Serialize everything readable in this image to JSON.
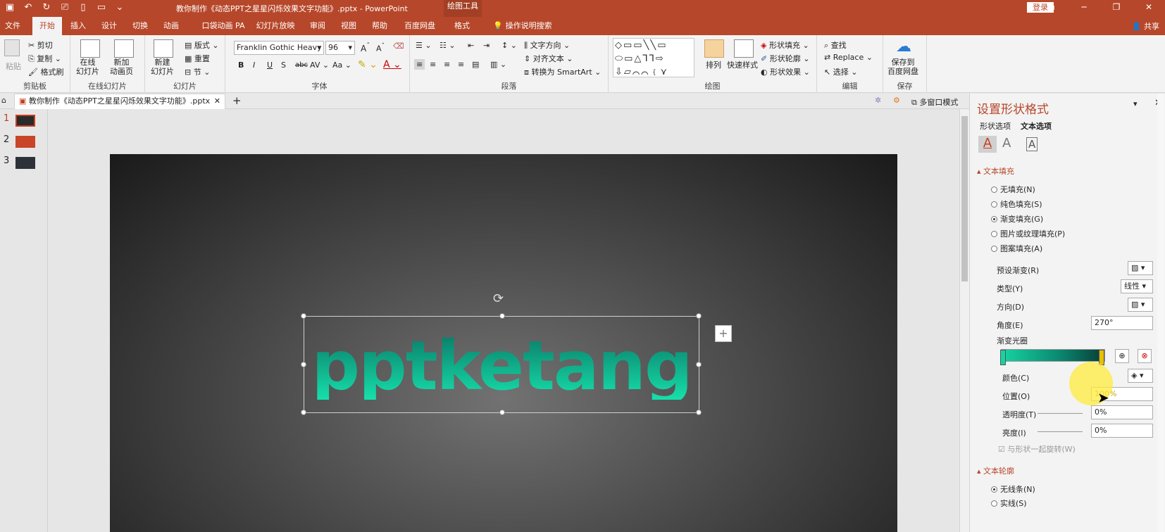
{
  "window": {
    "title": "教你制作《动态PPT之星星闪烁效果文字功能》.pptx  -  PowerPoint",
    "context_title": "绘图工具",
    "login": "登录"
  },
  "tabs": [
    "文件",
    "开始",
    "插入",
    "设计",
    "切换",
    "动画",
    "口袋动画 PA",
    "幻灯片放映",
    "审阅",
    "视图",
    "帮助",
    "百度网盘",
    "格式",
    "操作说明搜索"
  ],
  "active_tab": "开始",
  "share": "共享",
  "ribbon": {
    "clipboard": {
      "label": "剪贴板",
      "paste": "粘贴",
      "cut": "剪切",
      "copy": "复制",
      "format_painter": "格式刷"
    },
    "online": {
      "label": "在线幻灯片",
      "btn1": "在线\n幻灯片",
      "btn2": "新加\n动画页"
    },
    "slides": {
      "label": "幻灯片",
      "new": "新建\n幻灯片",
      "layout": "版式",
      "reset": "重置",
      "section": "节"
    },
    "font": {
      "label": "字体",
      "name": "Franklin Gothic Heavy",
      "size": "96"
    },
    "paragraph": {
      "label": "段落",
      "text_direction": "文字方向",
      "align_text": "对齐文本",
      "smartart": "转换为 SmartArt"
    },
    "drawing": {
      "label": "绘图",
      "arrange": "排列",
      "quick_styles": "快速样式",
      "fill": "形状填充",
      "outline": "形状轮廓",
      "effects": "形状效果"
    },
    "editing": {
      "label": "编辑",
      "find": "查找",
      "replace": "Replace",
      "select": "选择"
    },
    "save": {
      "label": "保存",
      "btn": "保存到\n百度网盘"
    }
  },
  "doc_tab": "教你制作《动态PPT之星星闪烁效果文字功能》.pptx",
  "multi_window": "多窗口模式",
  "slides": [
    {
      "num": "1"
    },
    {
      "num": "2"
    },
    {
      "num": "3"
    }
  ],
  "slide_text": "pptketang",
  "pane": {
    "title": "设置形状格式",
    "subtabs": [
      "形状选项",
      "文本选项"
    ],
    "fill_section": "文本填充",
    "fill_options": [
      {
        "label": "无填充(N)",
        "on": false
      },
      {
        "label": "纯色填充(S)",
        "on": false
      },
      {
        "label": "渐变填充(G)",
        "on": true
      },
      {
        "label": "图片或纹理填充(P)",
        "on": false
      },
      {
        "label": "图案填充(A)",
        "on": false
      }
    ],
    "preset_label": "预设渐变(R)",
    "type_label": "类型(Y)",
    "type_value": "线性",
    "direction_label": "方向(D)",
    "angle_label": "角度(E)",
    "angle_value": "270°",
    "stops_label": "渐变光圈",
    "color_label": "颜色(C)",
    "position_label": "位置(O)",
    "position_value": "100%",
    "transparency_label": "透明度(T)",
    "transparency_value": "0%",
    "brightness_label": "亮度(I)",
    "brightness_value": "0%",
    "rotate_label": "与形状一起旋转(W)",
    "outline_section": "文本轮廓",
    "outline_options": [
      {
        "label": "无线条(N)",
        "on": true
      },
      {
        "label": "实线(S)",
        "on": false
      }
    ]
  },
  "colors": {
    "accent": "#b7472a",
    "text_grad_top": "#0a7a68",
    "text_grad_bottom": "#16e0aa"
  }
}
